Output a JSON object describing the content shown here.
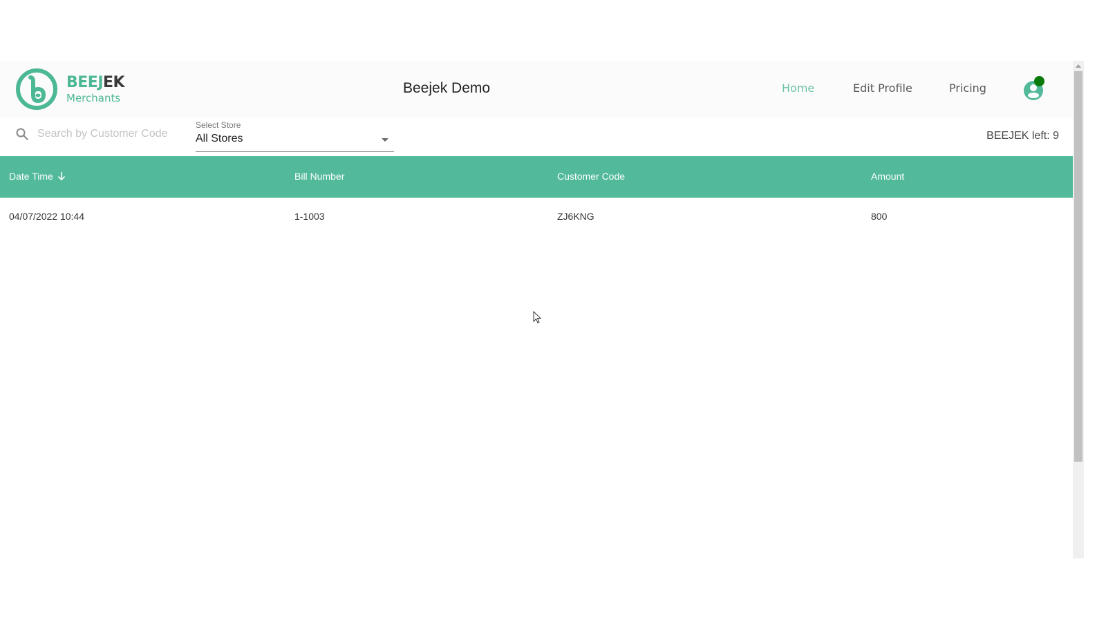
{
  "header": {
    "logo": {
      "brand_part1": "BEEJ",
      "brand_part2": "EK",
      "subtitle": "Merchants",
      "icon": "beejek-b-logo"
    },
    "title": "Beejek Demo",
    "nav": [
      {
        "label": "Home",
        "active": true
      },
      {
        "label": "Edit Profile",
        "active": false
      },
      {
        "label": "Pricing",
        "active": false
      }
    ],
    "avatar": {
      "icon": "user-avatar-icon",
      "status": "online"
    }
  },
  "toolbar": {
    "search": {
      "placeholder": "Search by Customer Code",
      "value": "",
      "icon": "search-icon"
    },
    "store_select": {
      "label": "Select Store",
      "value": "All Stores"
    },
    "credits_text": "BEEJEK left: 9"
  },
  "table": {
    "columns": [
      {
        "label": "Date Time",
        "sorted": "desc"
      },
      {
        "label": "Bill Number"
      },
      {
        "label": "Customer Code"
      },
      {
        "label": "Amount"
      }
    ],
    "rows": [
      {
        "datetime": "04/07/2022 10:44",
        "bill_number": "1-1003",
        "customer_code": "ZJ6KNG",
        "amount": "800"
      }
    ]
  },
  "colors": {
    "brand_green": "#4db896",
    "table_header": "#52b99a",
    "nav_active": "#6cc2a6",
    "status_dot": "#0a7a0a"
  }
}
